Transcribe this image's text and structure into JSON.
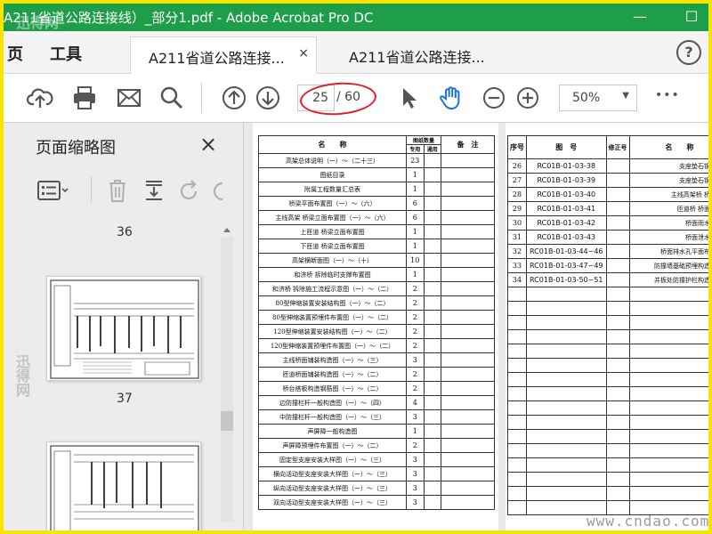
{
  "window": {
    "title": "A211省道公路连接线）_部分1.pdf - Adobe Acrobat Pro DC",
    "minimize": "—",
    "maximize": "☐"
  },
  "menu": {
    "page": "页",
    "tools": "工具"
  },
  "tabs": [
    {
      "label": "A211省道公路连接...",
      "close": "×"
    },
    {
      "label": "A211省道公路连接..."
    }
  ],
  "help": "?",
  "toolbar": {
    "current_page": "25",
    "total_pages": "/ 60",
    "zoom": "50%",
    "zoom_arrow": "▼",
    "more": "•••"
  },
  "sidebar": {
    "title": "页面缩略图",
    "close": "×",
    "thumbnails": [
      {
        "label": "36"
      },
      {
        "label": "37"
      }
    ]
  },
  "colors": {
    "titlebar": "#1f9e4a",
    "border": "#f5e500",
    "annotation": "#e0202a"
  },
  "doc_left": {
    "headers": {
      "name": "名　　称",
      "count_group": "图纸数量",
      "special": "专用",
      "common": "通用",
      "note": "备　注"
    },
    "rows": [
      {
        "name": "高架总体说明（一）～（二十三）",
        "count": "23"
      },
      {
        "name": "图纸目录",
        "count": "1"
      },
      {
        "name": "附属工程数量汇总表",
        "count": "1"
      },
      {
        "name": "桥梁平面布置图（一）～（六）",
        "count": "6"
      },
      {
        "name": "主线高架 桥梁立面布置图（一）～（六）",
        "count": "6"
      },
      {
        "name": "上匝道 桥梁立面布置图",
        "count": "1"
      },
      {
        "name": "下匝道 桥梁立面布置图",
        "count": "1"
      },
      {
        "name": "高架横断面图（一）～（十）",
        "count": "10"
      },
      {
        "name": "和济桥 拆除临时支撑布置图",
        "count": "1"
      },
      {
        "name": "和济桥 拆除施工流程示意图（一）～（二）",
        "count": "2"
      },
      {
        "name": "80型伸缩装置安装结构图（一）～（二）",
        "count": "2"
      },
      {
        "name": "80型伸缩装置预埋件布置图（一）～（二）",
        "count": "2"
      },
      {
        "name": "120型伸缩装置安装结构图（一）～（二）",
        "count": "2"
      },
      {
        "name": "120型伸缩装置预埋件布置图（一）～（二）",
        "count": "2"
      },
      {
        "name": "主线桥面铺装构造图（一）～（三）",
        "count": "3"
      },
      {
        "name": "匝道桥面铺装构造图（一）～（二）",
        "count": "2"
      },
      {
        "name": "桥台搭板构造钢筋图（一）～（二）",
        "count": "2"
      },
      {
        "name": "边防撞栏杆一般构造图（一）～（四）",
        "count": "4"
      },
      {
        "name": "中防撞栏杆一般构造图（一）～（三）",
        "count": "3"
      },
      {
        "name": "声屏障一般构造图",
        "count": "1"
      },
      {
        "name": "声屏障预埋件布置图（一）～（二）",
        "count": "2"
      },
      {
        "name": "固定型支座安装大样图（一）～（三）",
        "count": "3"
      },
      {
        "name": "横向活动型支座安装大样图（一）～（三）",
        "count": "3"
      },
      {
        "name": "纵向活动型支座安装大样图（一）～（三）",
        "count": "3"
      },
      {
        "name": "双向活动型支座安装大样图（一）～（三）",
        "count": "3"
      }
    ]
  },
  "doc_right": {
    "headers": {
      "seq": "序号",
      "drawing_no": "图　号",
      "revision": "修正号",
      "name": "名　　称"
    },
    "rows": [
      {
        "seq": "26",
        "no": "RC01B-01-03-38",
        "name": "支座垫石钢筋"
      },
      {
        "seq": "27",
        "no": "RC01B-01-03-39",
        "name": "支座垫石钢筋"
      },
      {
        "seq": "28",
        "no": "RC01B-01-03-40",
        "name": "主线高架桥 桥面"
      },
      {
        "seq": "29",
        "no": "RC01B-01-03-41",
        "name": "匝道桥 桥面排"
      },
      {
        "seq": "30",
        "no": "RC01B-01-03-42",
        "name": "桥面雨水口"
      },
      {
        "seq": "31",
        "no": "RC01B-01-03-43",
        "name": "桥面泄水口"
      },
      {
        "seq": "32",
        "no": "RC01B-01-03-44~46",
        "name": "桥面排水孔平面布置"
      },
      {
        "seq": "33",
        "no": "RC01B-01-03-47~49",
        "name": "防撞墙基础预埋构造钢"
      },
      {
        "seq": "34",
        "no": "RC01B-01-03-50~51",
        "name": "并板处防撞护栏构造钢"
      }
    ]
  },
  "watermark": "www.cndao.com",
  "logo_watermark": "迅得网"
}
